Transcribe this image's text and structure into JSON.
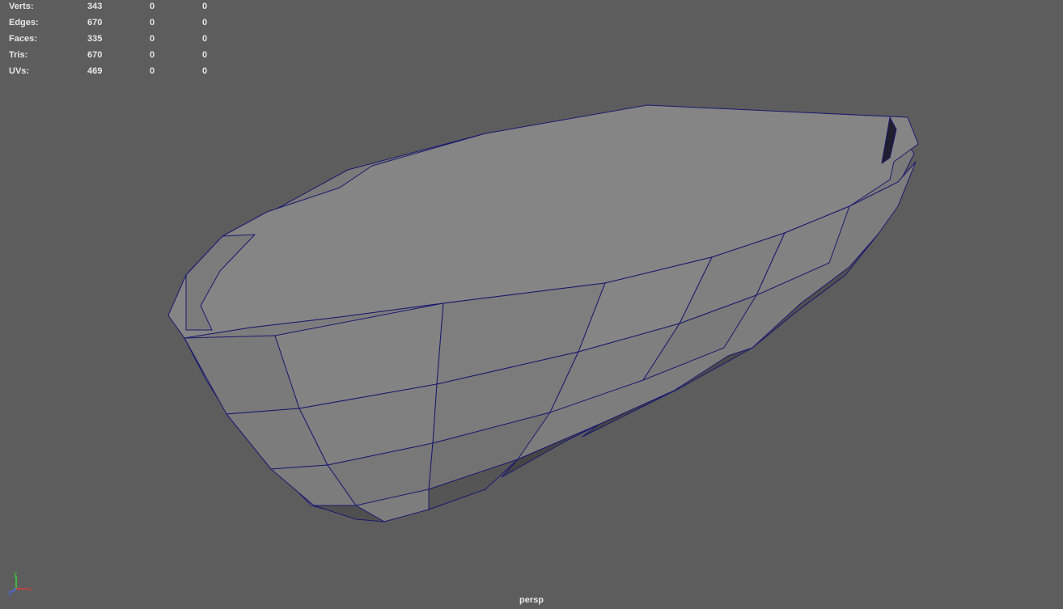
{
  "hud": {
    "rows": [
      {
        "label": "Verts:",
        "c1": "343",
        "c2": "0",
        "c3": "0"
      },
      {
        "label": "Edges:",
        "c1": "670",
        "c2": "0",
        "c3": "0"
      },
      {
        "label": "Faces:",
        "c1": "335",
        "c2": "0",
        "c3": "0"
      },
      {
        "label": "Tris:",
        "c1": "670",
        "c2": "0",
        "c3": "0"
      },
      {
        "label": "UVs:",
        "c1": "469",
        "c2": "0",
        "c3": "0"
      }
    ]
  },
  "viewport": {
    "camera_name": "persp",
    "background_color": "#5d5d5d",
    "wire_color": "#1a1a6e"
  },
  "gizmo": {
    "y_label": "y",
    "x_label": "x",
    "z_label": "z"
  }
}
